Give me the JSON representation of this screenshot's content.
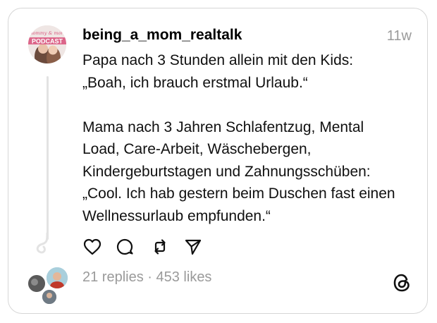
{
  "post": {
    "username": "being_a_mom_realtalk",
    "timestamp": "11w",
    "text": "Papa nach 3 Stunden allein mit den Kids:\n„Boah, ich brauch erstmal Urlaub.“\n\nMama nach 3 Jahren Schlafentzug, Mental Load, Care-Arbeit, Wäschebergen, Kindergeburtstagen und Zahnungsschüben:\n„Cool. Ich hab gestern beim Duschen fast einen Wellnessurlaub empfunden.“",
    "avatar_text": {
      "script": "mommy & more",
      "word": "PODCAST"
    }
  },
  "actions": [
    {
      "icon": "heart-icon",
      "label": "Like"
    },
    {
      "icon": "comment-icon",
      "label": "Reply"
    },
    {
      "icon": "repost-icon",
      "label": "Repost"
    },
    {
      "icon": "share-icon",
      "label": "Share"
    }
  ],
  "stats": {
    "replies": "21 replies",
    "separator": " · ",
    "likes": "453 likes"
  },
  "branding": {
    "logo": "threads-logo-icon"
  },
  "colors": {
    "text": "#101010",
    "muted": "#9a9a9a",
    "border": "#d6d6d6",
    "avatar_pink": "#e0679a"
  }
}
